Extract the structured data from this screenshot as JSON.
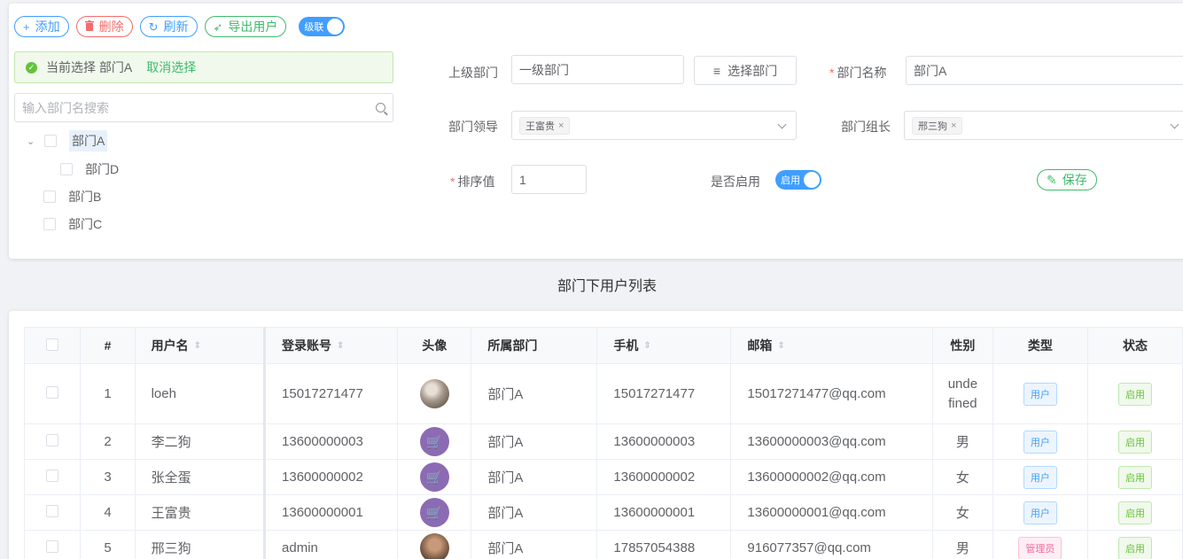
{
  "toolbar": {
    "add_label": "添加",
    "delete_label": "删除",
    "refresh_label": "刷新",
    "export_label": "导出用户",
    "cascade_label": "级联"
  },
  "selection": {
    "text": "当前选择 部门A",
    "cancel_label": "取消选择"
  },
  "search": {
    "placeholder": "输入部门名搜索"
  },
  "tree": [
    {
      "label": "部门A",
      "expanded": true,
      "selected": true
    },
    {
      "label": "部门D"
    },
    {
      "label": "部门B"
    },
    {
      "label": "部门C"
    }
  ],
  "form": {
    "parent_label": "上级部门",
    "parent_value": "一级部门",
    "choose_dept_label": "选择部门",
    "name_label": "部门名称",
    "name_value": "部门A",
    "leader_label": "部门领导",
    "leader_tag": "王富贵",
    "head_label": "部门组长",
    "head_tag": "邢三狗",
    "sort_label": "排序值",
    "sort_value": "1",
    "enabled_label": "是否启用",
    "enabled_switch": "启用",
    "save_label": "保存"
  },
  "section_title": "部门下用户列表",
  "table": {
    "headers": {
      "index": "#",
      "username": "用户名",
      "login": "登录账号",
      "avatar": "头像",
      "dept": "所属部门",
      "phone": "手机",
      "email": "邮箱",
      "gender": "性别",
      "type": "类型",
      "status": "状态"
    },
    "rows": [
      {
        "index": "1",
        "username": "loeh",
        "login": "15017271477",
        "avatar": "photo",
        "dept": "部门A",
        "phone": "15017271477",
        "email": "15017271477@qq.com",
        "gender": "undefined",
        "type": "用户",
        "status": "启用"
      },
      {
        "index": "2",
        "username": "李二狗",
        "login": "13600000003",
        "avatar": "cart-icon",
        "dept": "部门A",
        "phone": "13600000003",
        "email": "13600000003@qq.com",
        "gender": "男",
        "type": "用户",
        "status": "启用"
      },
      {
        "index": "3",
        "username": "张全蛋",
        "login": "13600000002",
        "avatar": "cart-icon",
        "dept": "部门A",
        "phone": "13600000002",
        "email": "13600000002@qq.com",
        "gender": "女",
        "type": "用户",
        "status": "启用"
      },
      {
        "index": "4",
        "username": "王富贵",
        "login": "13600000001",
        "avatar": "cart-icon",
        "dept": "部门A",
        "phone": "13600000001",
        "email": "13600000001@qq.com",
        "gender": "女",
        "type": "用户",
        "status": "启用"
      },
      {
        "index": "5",
        "username": "邢三狗",
        "login": "admin",
        "avatar": "photo",
        "dept": "部门A",
        "phone": "17857054388",
        "email": "916077357@qq.com",
        "gender": "男",
        "type": "管理员",
        "status": "启用"
      }
    ]
  }
}
